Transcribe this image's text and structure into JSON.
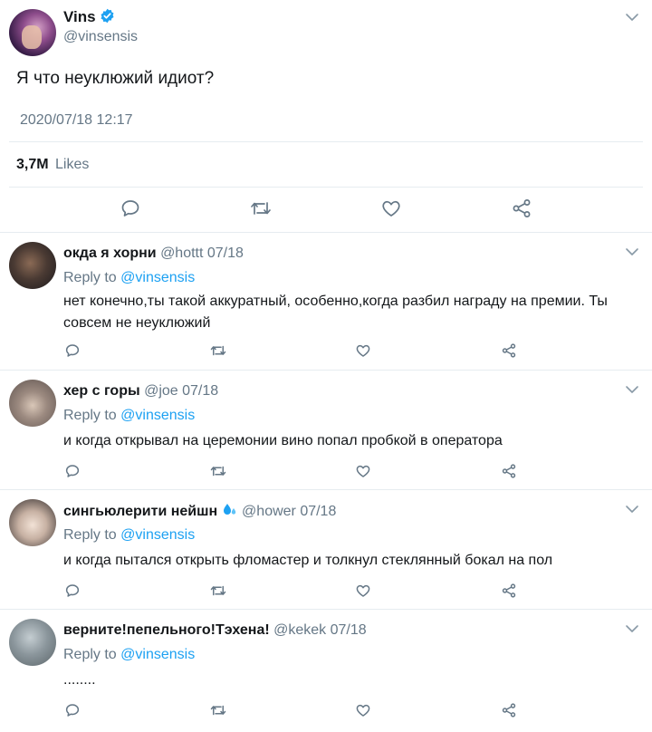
{
  "main_tweet": {
    "author_name": "Vins",
    "author_handle": "@vinsensis",
    "text": "Я что неуклюжий идиот?",
    "timestamp": "2020/07/18 12:17",
    "likes_count": "3,7M",
    "likes_label": "Likes",
    "icons": [
      "reply-icon",
      "retweet-icon",
      "like-icon",
      "share-icon",
      "chevron-down-icon",
      "verified-icon"
    ]
  },
  "reply_prefix": "Reply to",
  "replies": [
    {
      "name": "окда я хорни",
      "handle": "@hottt 07/18",
      "reply_to": "@vinsensis",
      "text": "нет конечно,ты такой аккуратный, особенно,когда разбил награду на премии. Ты совсем не неуклюжий"
    },
    {
      "name": "хер с горы",
      "handle": "@joe 07/18",
      "reply_to": "@vinsensis",
      "text": "и когда открывал на церемонии вино попал пробкой в оператора"
    },
    {
      "name": "сингьюлерити нейшн",
      "handle": "@hower 07/18",
      "reply_to": "@vinsensis",
      "text": "и когда пытался открыть фломастер и толкнул стеклянный бокал на пол"
    },
    {
      "name": "верните!пепельного!Тэхена!",
      "handle": "@kekek 07/18",
      "reply_to": "@vinsensis",
      "text": "........"
    }
  ],
  "colors": {
    "link": "#1da1f2",
    "secondary": "#657786",
    "icon": "#657786",
    "divider": "#e6ecf0",
    "verified": "#1da1f2"
  }
}
